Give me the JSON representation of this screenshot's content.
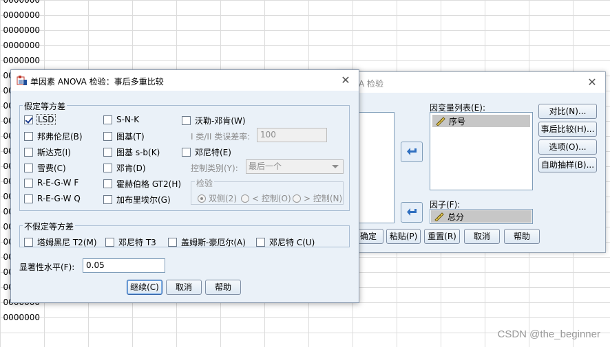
{
  "background": {
    "row_value": "0000000",
    "rows": 22,
    "watermark": "CSDN @the_beginner"
  },
  "back_dialog": {
    "title_partial": "A 检验",
    "dependent_list_label": "因变量列表(E):",
    "dependent_items": [
      "序号"
    ],
    "factor_label": "因子(F):",
    "factor_value": "总分",
    "side_buttons": [
      "对比(N)...",
      "事后比较(H)...",
      "选项(O)...",
      "自助抽样(B)..."
    ],
    "bottom_buttons": [
      "确定",
      "粘贴(P)",
      "重置(R)",
      "取消",
      "帮助"
    ]
  },
  "dialog": {
    "title": "单因素 ANOVA 检验：事后多重比较",
    "equal_variance": {
      "legend": "假定等方差",
      "options": [
        {
          "label": "LSD",
          "checked": true
        },
        {
          "label": "邦弗伦尼(B)",
          "checked": false
        },
        {
          "label": "斯达克(I)",
          "checked": false
        },
        {
          "label": "雪费(C)",
          "checked": false
        },
        {
          "label": "R-E-G-W F",
          "checked": false
        },
        {
          "label": "R-E-G-W Q",
          "checked": false
        },
        {
          "label": "S-N-K",
          "checked": false
        },
        {
          "label": "图基(T)",
          "checked": false
        },
        {
          "label": "图基 s-b(K)",
          "checked": false
        },
        {
          "label": "邓肯(D)",
          "checked": false
        },
        {
          "label": "霍赫伯格 GT2(H)",
          "checked": false
        },
        {
          "label": "加布里埃尔(G)",
          "checked": false
        },
        {
          "label": "沃勒-邓肯(W)",
          "checked": false
        },
        {
          "label": "邓尼特(E)",
          "checked": false
        }
      ],
      "error_ratio_label": "I 类/II 类误差率:",
      "error_ratio_value": "100",
      "control_category_label": "控制类别(Y):",
      "control_category_value": "最后一个",
      "test_legend": "检验",
      "test_options": [
        {
          "label": "双侧(2)",
          "selected": true
        },
        {
          "label": "< 控制(O)",
          "selected": false
        },
        {
          "label": "> 控制(N)",
          "selected": false
        }
      ]
    },
    "unequal_variance": {
      "legend": "不假定等方差",
      "options": [
        {
          "label": "塔姆黑尼 T2(M)",
          "checked": false
        },
        {
          "label": "邓尼特 T3",
          "checked": false
        },
        {
          "label": "盖姆斯-豪厄尔(A)",
          "checked": false
        },
        {
          "label": "邓尼特 C(U)",
          "checked": false
        }
      ]
    },
    "significance_label": "显著性水平(F):",
    "significance_value": "0.05",
    "buttons": {
      "continue": "继续(C)",
      "cancel": "取消",
      "help": "帮助"
    }
  },
  "colors": {
    "dialog_bg": "#eaf1f8",
    "accent_arrow": "#2f6fc0"
  }
}
